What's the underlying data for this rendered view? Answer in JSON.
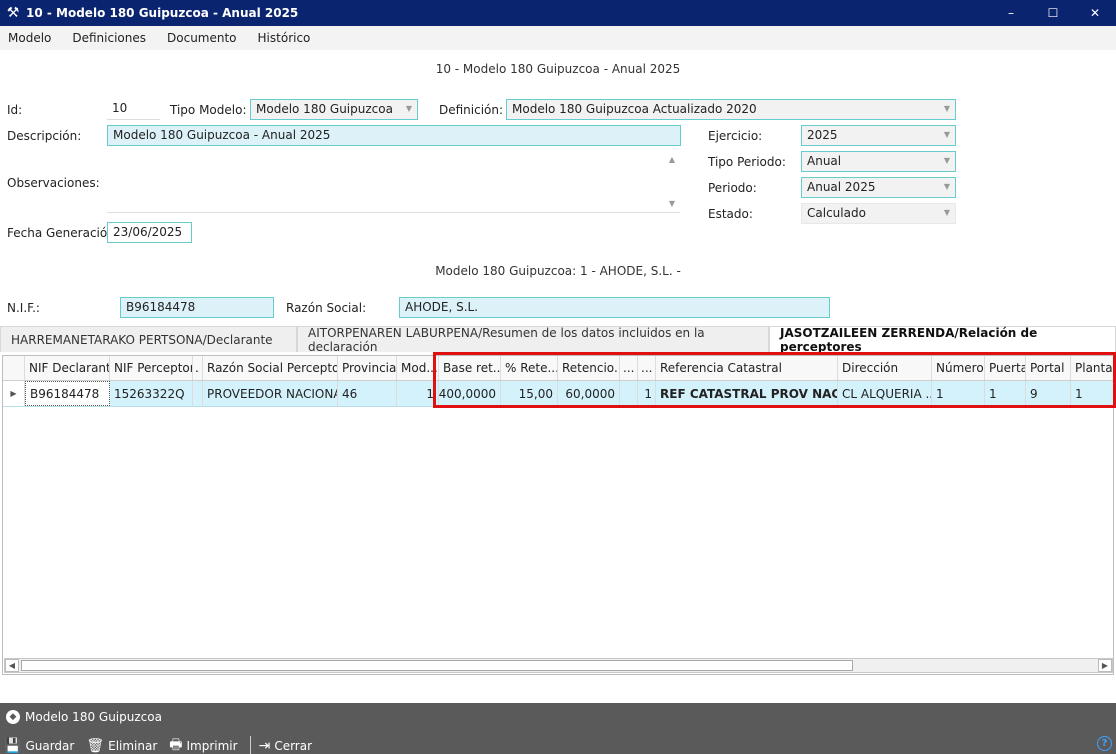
{
  "window": {
    "title": "10 - Modelo 180 Guipuzcoa - Anual 2025",
    "min": "–",
    "max": "☐",
    "close": "✕"
  },
  "menu": [
    "Modelo",
    "Definiciones",
    "Documento",
    "Histórico"
  ],
  "header_caption": "10 - Modelo 180 Guipuzcoa - Anual 2025",
  "form": {
    "id_label": "Id:",
    "id_value": "10",
    "tipo_modelo_label": "Tipo Modelo:",
    "tipo_modelo_value": "Modelo 180 Guipuzcoa",
    "definicion_label": "Definición:",
    "definicion_value": "Modelo 180 Guipuzcoa Actualizado 2020",
    "descripcion_label": "Descripción:",
    "descripcion_value": "Modelo 180 Guipuzcoa - Anual 2025",
    "observaciones_label": "Observaciones:",
    "fecha_label": "Fecha Generación:",
    "fecha_value": "23/06/2025",
    "ejercicio_label": "Ejercicio:",
    "ejercicio_value": "2025",
    "tipo_periodo_label": "Tipo Periodo:",
    "tipo_periodo_value": "Anual",
    "periodo_label": "Periodo:",
    "periodo_value": "Anual 2025",
    "estado_label": "Estado:",
    "estado_value": "Calculado"
  },
  "declarante_caption": "Modelo 180 Guipuzcoa: 1 - AHODE, S.L. -",
  "declarante": {
    "nif_label": "N.I.F.:",
    "nif_value": "B96184478",
    "razon_label": "Razón Social:",
    "razon_value": "AHODE, S.L."
  },
  "tabs": [
    "HARREMANETARAKO PERTSONA/Declarante",
    "AITORPENAREN LABURPENA/Resumen de los datos incluidos en la declaración",
    "JASOTZAILEEN ZERRENDA/Relación de perceptores"
  ],
  "grid": {
    "columns": [
      "NIF Declarante",
      "NIF Perceptor",
      ".",
      "Razón Social Perceptor",
      "Provincia",
      "Mod...",
      "Base ret...",
      "% Rete...",
      "Retencio...",
      "...",
      "...",
      "Referencia Catastral",
      "Dirección",
      "Número",
      "Puerta",
      "Portal",
      "Planta"
    ],
    "rows": [
      [
        "B96184478",
        "15263322Q",
        "",
        "PROVEEDOR NACIONAL",
        "46",
        "1",
        "400,0000",
        "15,00",
        "60,0000",
        "",
        "1",
        "REF CATASTRAL PROV NACIO...",
        "CL ALQUERIA ...",
        "1",
        "1",
        "9",
        "1"
      ]
    ]
  },
  "statusbar": {
    "form_name": "Modelo 180 Guipuzcoa",
    "buttons": {
      "save": "Guardar",
      "delete": "Eliminar",
      "print": "Imprimir",
      "close": "Cerrar"
    }
  }
}
